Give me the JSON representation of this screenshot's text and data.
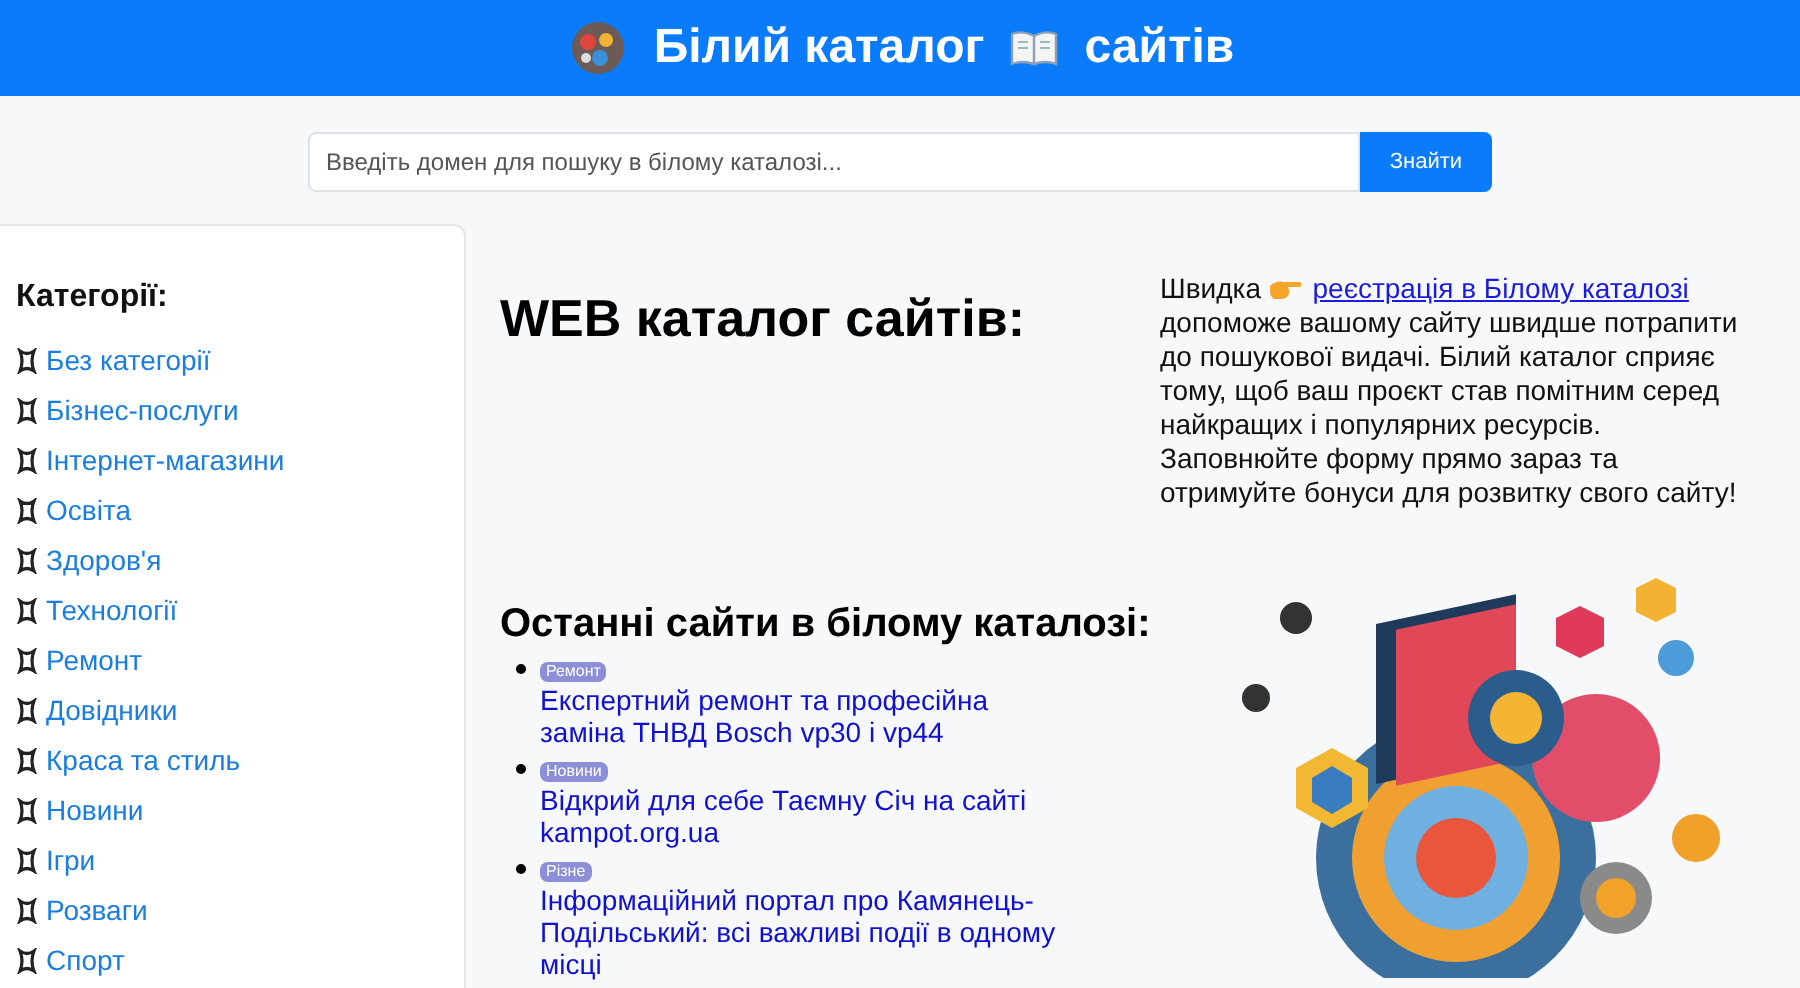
{
  "header": {
    "title_before_icon": "Білий каталог",
    "title_after_icon": "сайтів"
  },
  "search": {
    "placeholder": "Введіть домен для пошуку в білому каталозі...",
    "button": "Знайти"
  },
  "sidebar": {
    "heading": "Категорії:",
    "items": [
      "Без категорії",
      "Бізнес-послуги",
      "Інтернет-магазини",
      "Освіта",
      "Здоров'я",
      "Технології",
      "Ремонт",
      "Довідники",
      "Краса та стиль",
      "Новини",
      "Ігри",
      "Розваги",
      "Спорт"
    ]
  },
  "main": {
    "heading": "WEB каталог сайтів:",
    "intro_before_link": "Швидка",
    "intro_link": "реєстрація в Білому каталозі",
    "intro_after_link": "допоможе вашому сайту швидше потрапити до пошукової видачі. Білий каталог сприяє тому, щоб ваш проєкт став помітним серед найкращих і популярних ресурсів. Заповнюйте форму прямо зараз та отримуйте бонуси для розвитку свого сайту!",
    "latest_heading": "Останні сайти в білому каталозі:",
    "latest": [
      {
        "tag": "Ремонт",
        "title": "Експертний ремонт та професійна заміна ТНВД Bosch vp30 і vp44"
      },
      {
        "tag": "Новини",
        "title": "Відкрий для себе Таємну Січ на сайті kampot.org.ua"
      },
      {
        "tag": "Різне",
        "title": "Інформаційний портал про Камянець-Подільський: всі важливі події в одному місці"
      }
    ]
  }
}
